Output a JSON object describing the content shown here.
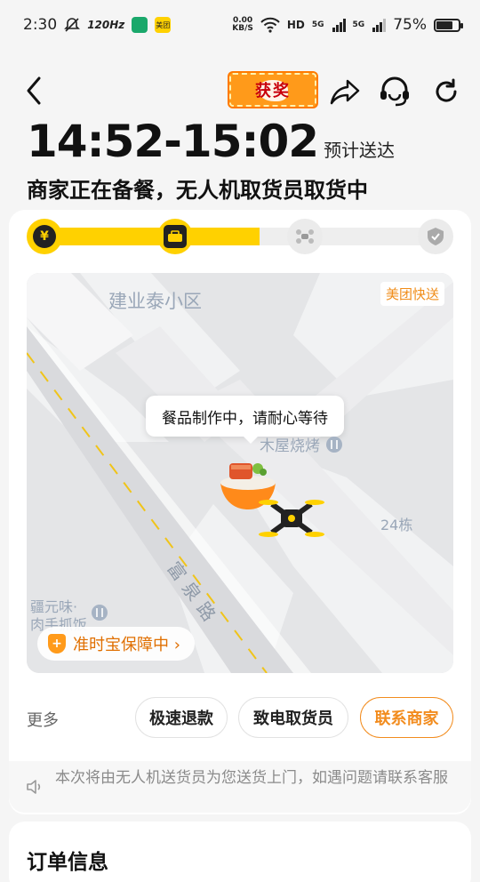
{
  "status_bar": {
    "time": "2:30",
    "refresh_rate": "120Hz",
    "net_speed_value": "0.00",
    "net_speed_unit": "KB/S",
    "hd": "HD",
    "sim1": "5G",
    "sim2": "5G",
    "battery": "75%",
    "battery_level": 0.75,
    "app1_label": "",
    "app2_label": "美团"
  },
  "header": {
    "reward_badge": "获奖"
  },
  "delivery": {
    "eta_time": "14:52-15:02",
    "eta_label": "预计送达",
    "status_title": "商家正在备餐，无人机取货员取货中",
    "progress_fraction": 0.55,
    "steps": [
      {
        "icon": "payment-icon",
        "state": "done"
      },
      {
        "icon": "merchant-icon",
        "state": "done"
      },
      {
        "icon": "drone-icon",
        "state": "todo"
      },
      {
        "icon": "check-icon",
        "state": "todo"
      }
    ]
  },
  "map": {
    "brand_tag": "美团快送",
    "community_label": "建业泰小区",
    "bubble_text": "餐品制作中，请耐心等待",
    "poi_shop": "木屋烧烤",
    "poi_building": "24栋",
    "road_label": "富泉路",
    "poi_restaurant_line1": "疆元味·",
    "poi_restaurant_line2": "肉手抓饭",
    "on_time_label": "准时宝保障中 ›"
  },
  "actions": {
    "more_label": "更多",
    "refund_label": "极速退款",
    "call_courier_label": "致电取货员",
    "contact_merchant_label": "联系商家"
  },
  "notice": {
    "text": "本次将由无人机送货员为您送货上门，如遇问题请联系客服"
  },
  "order": {
    "title": "订单信息"
  },
  "colors": {
    "accent": "#ffd100",
    "brand_orange": "#f28c1e"
  }
}
